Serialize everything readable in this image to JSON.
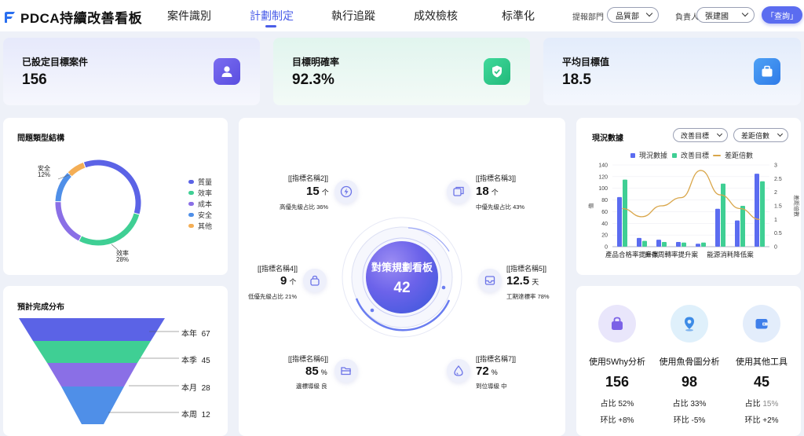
{
  "header": {
    "logo_text": "PDCA持續改善看板",
    "tabs": [
      {
        "label": "案件識別",
        "active": false
      },
      {
        "label": "計劃制定",
        "active": true
      },
      {
        "label": "執行追蹤",
        "active": false
      },
      {
        "label": "成效檢核",
        "active": false
      },
      {
        "label": "标準化",
        "active": false
      }
    ],
    "filters": {
      "dept_label": "提報部門",
      "dept_value": "品質部",
      "owner_label": "負責人",
      "owner_value": "張建國",
      "query_button": "「查詢」"
    },
    "accent": "#4a5de8"
  },
  "stats": [
    {
      "label": "已設定目標案件",
      "value": "156",
      "icon": "user-icon"
    },
    {
      "label": "目標明確率",
      "value": "92.3%",
      "icon": "shield-check-icon"
    },
    {
      "label": "平均目標值",
      "value": "18.5",
      "icon": "briefcase-icon"
    }
  ],
  "problem_types": {
    "title": "問題類型結構",
    "slices": [
      {
        "name": "質量",
        "value": 35,
        "color": "#5b63e6"
      },
      {
        "name": "效率",
        "value": 28,
        "color": "#3fcf94"
      },
      {
        "name": "成本",
        "value": 18,
        "color": "#8a6fe6"
      },
      {
        "name": "安全",
        "value": 12,
        "color": "#4f8fe8"
      },
      {
        "name": "其他",
        "value": 7,
        "color": "#f4ae55"
      }
    ],
    "callouts": [
      {
        "name": "安全",
        "pct": "12%"
      },
      {
        "name": "效率",
        "pct": "28%"
      }
    ]
  },
  "center_board": {
    "title": "對策規劃看板",
    "value": "42",
    "nodes": [
      {
        "title": "[[指標名稱2]]",
        "value": "15",
        "unit": "个",
        "sub": "高優先級占比 36%",
        "icon": "lightning-icon"
      },
      {
        "title": "[[指標名稱3]]",
        "value": "18",
        "unit": "个",
        "sub": "中優先級占比 43%",
        "icon": "folder-stack-icon"
      },
      {
        "title": "[[指標名稱4]]",
        "value": "9",
        "unit": "个",
        "sub": "低優先級占比 21%",
        "icon": "bag-icon"
      },
      {
        "title": "[[指標名稱5]]",
        "value": "12.5",
        "unit": "天",
        "sub": "工期達標率 78%",
        "icon": "inbox-icon"
      },
      {
        "title": "[[指標名稱6]]",
        "value": "85",
        "unit": "%",
        "sub": "邊標導級 良",
        "icon": "folder-open-icon"
      },
      {
        "title": "[[指標名稱7]]",
        "value": "72",
        "unit": "%",
        "sub": "到位導級 中",
        "icon": "droplet-icon"
      }
    ]
  },
  "status_chart": {
    "title": "現況數據",
    "select_1": "改善目標",
    "select_2": "差距倍數",
    "legend": [
      "現況數據",
      "改善目標",
      "差距倍數"
    ],
    "colors": {
      "current": "#5b6cf0",
      "target": "#3fcf94",
      "gap": "#d9a64a"
    }
  },
  "chart_data": {
    "type": "bar",
    "title": "",
    "categories": [
      "產品合格率提升案",
      "",
      "庫存周轉率提升案",
      "",
      "",
      "能源消耗降低案",
      "",
      ""
    ],
    "series": [
      {
        "name": "現況數據",
        "type": "bar",
        "axis": "left",
        "values": [
          85,
          15,
          12,
          8,
          5,
          65,
          45,
          125
        ]
      },
      {
        "name": "改善目標",
        "type": "bar",
        "axis": "left",
        "values": [
          115,
          10,
          8,
          7,
          7,
          108,
          70,
          112
        ]
      },
      {
        "name": "差距倍數",
        "type": "line",
        "axis": "right",
        "values": [
          1.4,
          1.1,
          1.5,
          1.8,
          2.8,
          1.9,
          1.4,
          1.0
        ]
      }
    ],
    "ylabel": "值",
    "ylabel_right": "差距倍數",
    "ylim": [
      0,
      140
    ],
    "yticks": [
      0,
      20,
      40,
      60,
      80,
      100,
      120,
      140
    ],
    "ylim_right": [
      0,
      3
    ],
    "yticks_right": [
      "0",
      "0.5",
      "1",
      "1.5",
      "2",
      "2.5",
      "3"
    ],
    "legend_position": "top"
  },
  "funnel": {
    "title": "預計完成分布",
    "levels": [
      {
        "label": "本年",
        "value": "67",
        "color": "#5b63e6"
      },
      {
        "label": "本季",
        "value": "45",
        "color": "#3fcf94"
      },
      {
        "label": "本月",
        "value": "28",
        "color": "#8a6fe6"
      },
      {
        "label": "本周",
        "value": "12",
        "color": "#4f8fe8"
      }
    ]
  },
  "tools": [
    {
      "name": "使用5Why分析",
      "value": "156",
      "share_label": "占比",
      "share": "52%",
      "ring_label": "环比",
      "ring": "+8%",
      "icon": "bag-icon",
      "color": "#e9e6fb",
      "fg": "#7b62e6"
    },
    {
      "name": "使用魚骨圖分析",
      "value": "98",
      "share_label": "占比",
      "share": "33%",
      "ring_label": "环比",
      "ring": "-5%",
      "icon": "location-pin-icon",
      "color": "#dff0fb",
      "fg": "#3d8be6"
    },
    {
      "name": "使用其他工具",
      "value": "45",
      "share_label": "占比",
      "share": "15%",
      "ring_label": "环比",
      "ring": "+2%",
      "icon": "wallet-icon",
      "color": "#e3edfb",
      "fg": "#3f7fea"
    }
  ]
}
